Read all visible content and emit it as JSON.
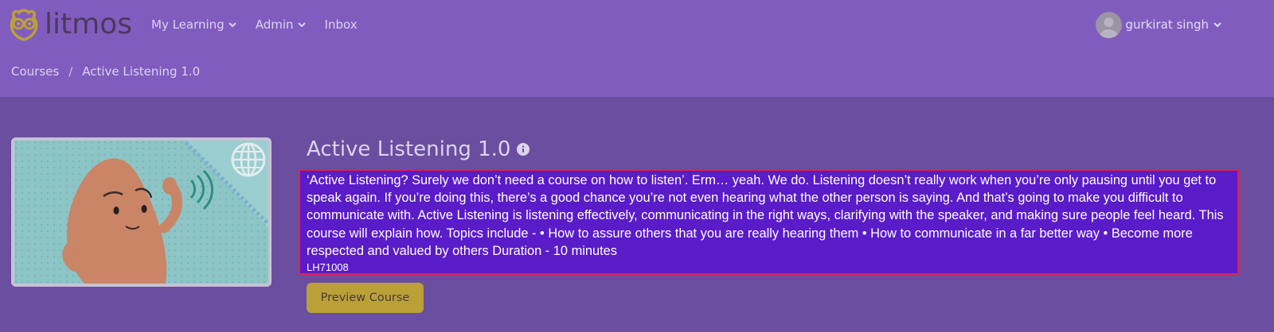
{
  "brand": {
    "name": "litmos"
  },
  "nav": {
    "my_learning": "My Learning",
    "admin": "Admin",
    "inbox": "Inbox"
  },
  "user": {
    "name": "gurkirat singh"
  },
  "breadcrumb": {
    "courses": "Courses",
    "separator": "/",
    "current": "Active Listening 1.0"
  },
  "course": {
    "title": "Active Listening 1.0",
    "description": "‘Active Listening? Surely we don’t need a course on how to listen’. Erm… yeah. We do. Listening doesn’t really work when you’re only pausing until you get to speak again. If you’re doing this, there’s a good chance you’re not even hearing what the other person is saying. And that’s going to make you difficult to communicate with. Active Listening is listening effectively, communicating in the right ways, clarifying with the speaker, and making sure people feel heard. This course will explain how. Topics include - • How to assure others that you are really hearing them • How to communicate in a far better way • Become more respected and valued by others Duration - 10 minutes",
    "code": "LH71008",
    "preview_button": "Preview Course"
  },
  "colors": {
    "header_bg": "#815cbf",
    "page_bg": "#6a4ea0",
    "description_bg": "#5a1bc8",
    "highlight_border": "#e4204a",
    "button_bg": "#bba038"
  },
  "icons": {
    "logo": "owl-glasses-logo",
    "dropdown": "chevron-down-icon",
    "info": "info-icon",
    "avatar": "user-avatar",
    "globe": "globe-icon"
  }
}
